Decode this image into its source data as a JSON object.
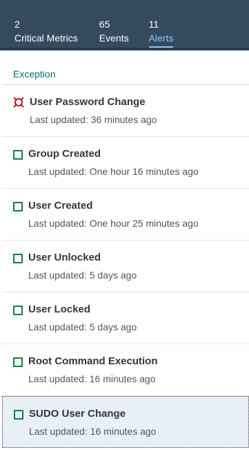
{
  "header": {
    "tabs": [
      {
        "count": "2",
        "label": "Critical Metrics",
        "selected": false
      },
      {
        "count": "65",
        "label": "Events",
        "selected": false
      },
      {
        "count": "11",
        "label": "Alerts",
        "selected": true
      }
    ]
  },
  "group": {
    "title": "Exception"
  },
  "items": [
    {
      "title": "User Password Change",
      "subtitle": "Last updated: 36 minutes ago",
      "icon": "critical-alert-icon"
    },
    {
      "title": "Group Created",
      "subtitle": "Last updated: One hour 16 minutes ago",
      "icon": "status-square-icon"
    },
    {
      "title": "User Created",
      "subtitle": "Last updated: One hour 25 minutes ago",
      "icon": "status-square-icon"
    },
    {
      "title": "User Unlocked",
      "subtitle": "Last updated: 5 days ago",
      "icon": "status-square-icon"
    },
    {
      "title": "User Locked",
      "subtitle": "Last updated: 5 days ago",
      "icon": "status-square-icon"
    },
    {
      "title": "Root Command Execution",
      "subtitle": "Last updated: 16 minutes ago",
      "icon": "status-square-icon"
    },
    {
      "title": "SUDO User Change",
      "subtitle": "Last updated: 16 minutes ago",
      "icon": "status-square-icon"
    }
  ],
  "colors": {
    "header_bg": "#354a5f",
    "selected_tab": "#91c8f6",
    "group_title": "#0a6e6e",
    "critical": "#bb0000",
    "success": "#107e3e",
    "selected_row_bg": "#e8eff6"
  }
}
